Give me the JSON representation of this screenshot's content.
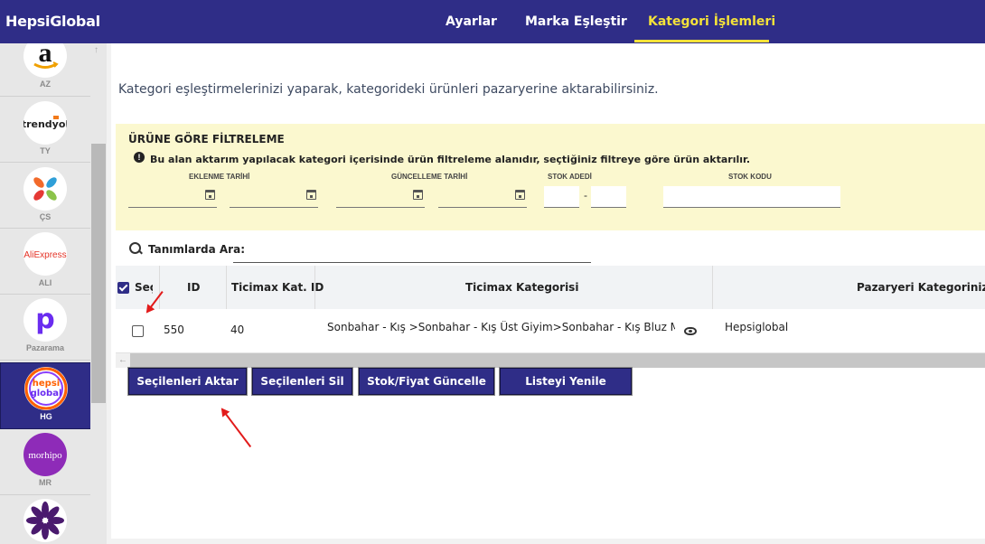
{
  "app": {
    "brand": "HepsiGlobal"
  },
  "nav": {
    "tabs": [
      {
        "label": "Ayarlar"
      },
      {
        "label": "Marka Eşleştir"
      },
      {
        "label": "Kategori İşlemleri"
      }
    ],
    "active_index": 2,
    "accent": "#f4e23a"
  },
  "sidebar": {
    "items": [
      {
        "label": "AZ",
        "icon": "amazon-logo-icon"
      },
      {
        "label": "TY",
        "icon": "trendyol-logo-icon"
      },
      {
        "label": "ÇS",
        "icon": "ciceksepeti-logo-icon"
      },
      {
        "label": "ALI",
        "icon": "aliexpress-logo-icon"
      },
      {
        "label": "Pazarama",
        "icon": "pazarama-logo-icon"
      },
      {
        "label": "HG",
        "icon": "hepsiglobal-logo-icon"
      },
      {
        "label": "MR",
        "icon": "morhipo-logo-icon"
      }
    ],
    "logo_texts": {
      "trendyol": "trendyol",
      "aliexpress": "AliExpress",
      "hepsiglobal_top": "hepsi",
      "hepsiglobal_bottom": "global",
      "morhipo": "morhipo",
      "amazon": "a",
      "pazarama": "p"
    },
    "active_index": 5
  },
  "intro_text": "Kategori eşleştirmelerinizi yaparak, kategorideki ürünleri pazaryerine aktarabilirsiniz.",
  "filter": {
    "title": "ÜRÜNE GÖRE FİLTRELEME",
    "info": "Bu alan aktarım yapılacak kategori içerisinde ürün filtreleme alanıdır, seçtiğiniz filtreye göre ürün aktarılır.",
    "labels": {
      "created": "EKLENME TARİHİ",
      "updated": "GÜNCELLEME TARİHİ",
      "stock": "STOK ADEDİ",
      "stock_code": "STOK KODU"
    },
    "stock_separator": "-"
  },
  "search": {
    "label": "Tanımlarda Ara:",
    "value": ""
  },
  "table": {
    "headers": {
      "select": "Seç",
      "id": "ID",
      "ticimax_id": "Ticimax Kat. ID",
      "ticimax_cat": "Ticimax Kategorisi",
      "market_cat": "Pazaryeri Kategoriniz"
    },
    "rows": [
      {
        "id": "550",
        "ticimax_id": "40",
        "ticimax_cat": "Sonbahar - Kış >Sonbahar - Kış Üst Giyim>Sonbahar - Kış Bluz Modelleri",
        "market_cat": "Hepsiglobal",
        "checked": false
      }
    ]
  },
  "buttons": {
    "transfer": "Seçilenleri Aktar",
    "delete": "Seçilenleri Sil",
    "update_stock": "Stok/Fiyat Güncelle",
    "refresh": "Listeyi Yenile"
  },
  "colors": {
    "primary": "#2f2d87",
    "accent": "#f4e23a",
    "filter_bg": "#fbf8cf",
    "annotation": "#e21b1b"
  }
}
